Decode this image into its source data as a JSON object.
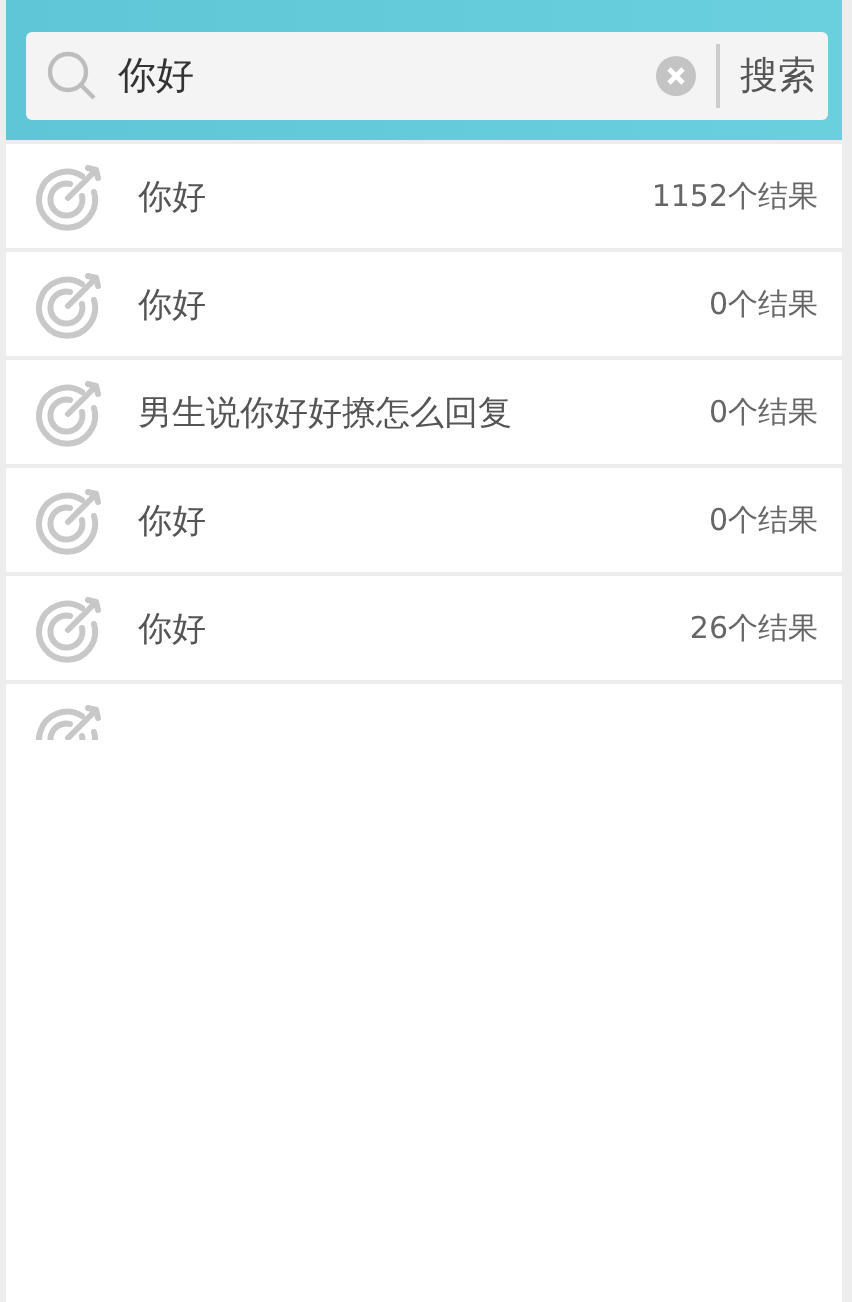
{
  "search": {
    "value": "你好",
    "button": "搜索"
  },
  "results": [
    {
      "query": "你好",
      "count": "1152个结果"
    },
    {
      "query": "你好",
      "count": "0个结果"
    },
    {
      "query": "男生说你好好撩怎么回复",
      "count": "0个结果"
    },
    {
      "query": "你好",
      "count": "0个结果"
    },
    {
      "query": "你好",
      "count": "26个结果"
    }
  ]
}
